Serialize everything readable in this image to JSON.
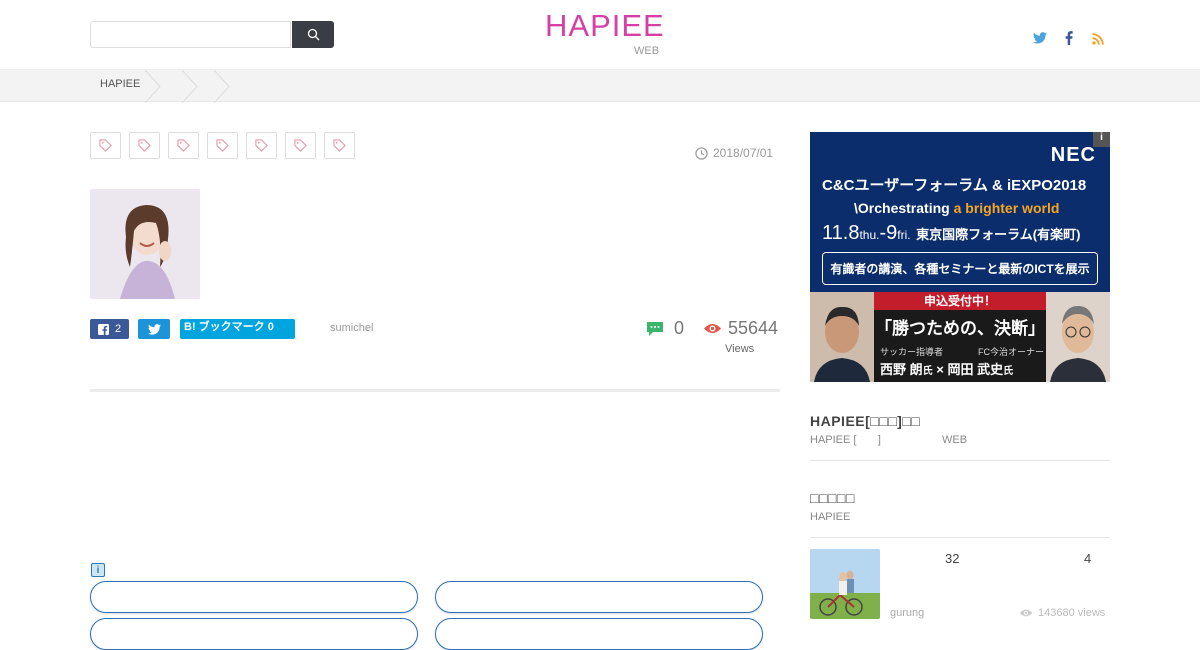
{
  "header": {
    "search": {
      "placeholder": "",
      "value": ""
    },
    "logo": "HAPIEE",
    "logo_sub": "WEB",
    "social_icons": [
      "twitter-icon",
      "facebook-icon",
      "rss-icon"
    ]
  },
  "breadcrumb": {
    "home": "HAPIEE"
  },
  "article": {
    "date": "2018/07/01",
    "share": {
      "facebook_count": "2",
      "hatena_label": "B! ブックマーク 0"
    },
    "author": "sumichel",
    "comments": "0",
    "views": "55644",
    "views_label": "Views"
  },
  "ad_info_label": "i",
  "banner": {
    "info": "i",
    "brand": "NEC",
    "line1": "C&Cユーザーフォーラム & iEXPO2018",
    "line2_a": "\\Orchestrating ",
    "line2_b": "a brighter world",
    "date_a": "11.8",
    "date_b": "thu.",
    "date_c": "-9",
    "date_d": "fri.",
    "venue": "東京国際フォーラム(有楽町)",
    "box_text": "有識者の講演、各種セミナーと最新のICTを展示",
    "red_label": "申込受付中！",
    "quote": "「勝つための、決断」",
    "role1": "サッカー指導者",
    "role2": "FC今治オーナー",
    "name1": "西野 朗",
    "hon1": "氏",
    "times": "×",
    "name2": "岡田 武史",
    "hon2": "氏"
  },
  "sidebar": {
    "section1": {
      "title": "HAPIEE[□□□]□□",
      "sub": "HAPIEE [       ]                    WEB"
    },
    "section2": {
      "title": "□□□□□",
      "sub": "HAPIEE"
    },
    "item": {
      "num_a": "32",
      "num_b": "4",
      "author": "gurung",
      "views": "143680 views"
    }
  },
  "colors": {
    "logo": "#d63fa5",
    "facebook": "#3b5998",
    "twitter": "#1d94d8",
    "hatena": "#00a4de",
    "banner": "#0b2d6b"
  }
}
